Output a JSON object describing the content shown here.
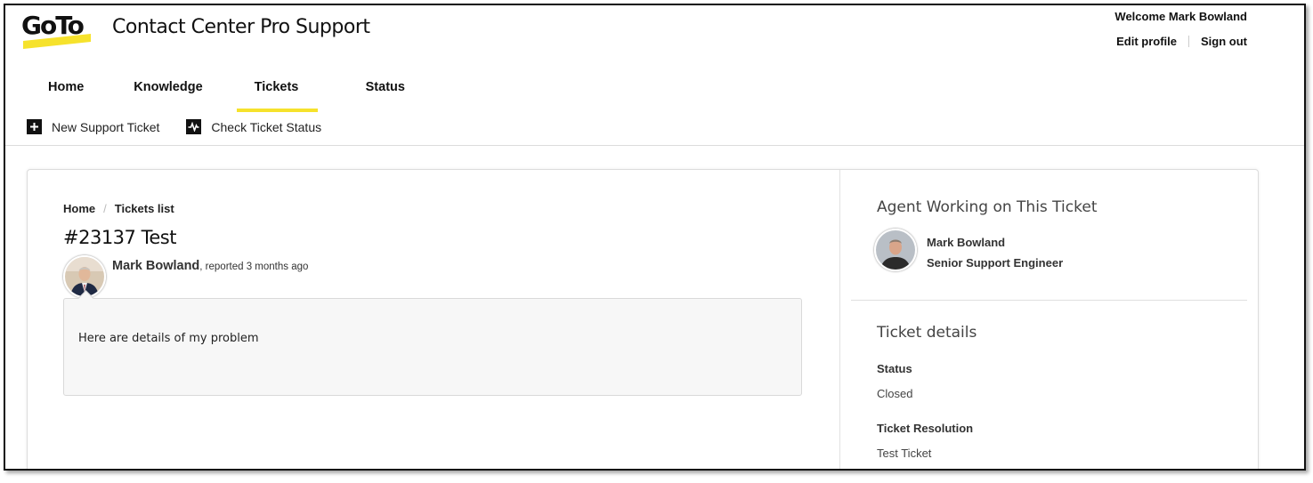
{
  "header": {
    "logo_text": "GoTo",
    "site_title": "Contact Center Pro Support",
    "welcome": "Welcome Mark Bowland",
    "edit_profile": "Edit profile",
    "sign_out": "Sign out",
    "brand_color": "#f6e22c"
  },
  "nav": {
    "items": [
      {
        "label": "Home",
        "active": false
      },
      {
        "label": "Knowledge",
        "active": false
      },
      {
        "label": "Tickets",
        "active": true
      },
      {
        "label": "Status",
        "active": false
      }
    ]
  },
  "actions": {
    "new_ticket": {
      "label": "New Support Ticket",
      "icon": "plus-icon"
    },
    "check_status": {
      "label": "Check Ticket Status",
      "icon": "activity-icon"
    }
  },
  "ticket": {
    "breadcrumb": [
      "Home",
      "Tickets list"
    ],
    "breadcrumb_separator": "/",
    "title": "#23137 Test",
    "reporter_name": "Mark Bowland",
    "reported_text": ", reported 3 months ago",
    "comment": "Here are details of my problem"
  },
  "sidebar": {
    "agent_heading": "Agent Working on This Ticket",
    "agent_name": "Mark Bowland",
    "agent_title": "Senior Support Engineer",
    "details_heading": "Ticket details",
    "status_label": "Status",
    "status_value": "Closed",
    "resolution_label": "Ticket Resolution",
    "resolution_value": "Test Ticket"
  }
}
